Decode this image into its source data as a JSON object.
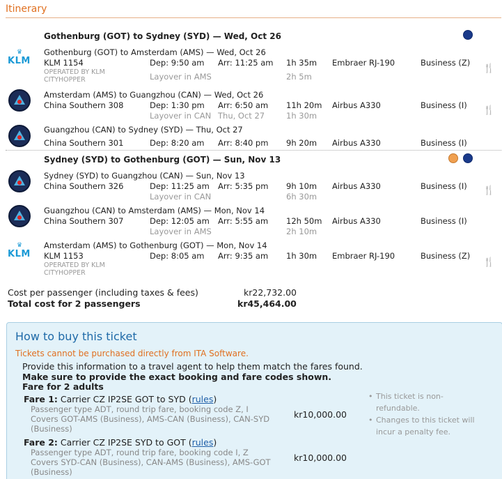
{
  "section_title": "Itinerary",
  "slices": [
    {
      "header": "Gothenburg (GOT) to Sydney (SYD) — Wed, Oct 26",
      "flights": [
        {
          "route": "Gothenburg (GOT) to Amsterdam (AMS) — Wed, Oct 26",
          "carrier": "KLM 1154",
          "operated_by": "OPERATED BY KLM CITYHOPPER",
          "dep": "Dep: 9:50 am",
          "arr": "Arr: 11:25 am",
          "duration": "1h 35m",
          "aircraft": "Embraer RJ-190",
          "cabin": "Business (Z)",
          "layover": "Layover in AMS",
          "layover_duration": "2h 5m",
          "logo": "klm-logo"
        },
        {
          "route": "Amsterdam (AMS) to Guangzhou (CAN) — Wed, Oct 26",
          "carrier": "China Southern 308",
          "dep": "Dep: 1:30 pm",
          "arr": "Arr: 6:50 am",
          "duration": "11h 20m",
          "aircraft": "Airbus A330",
          "cabin": "Business (I)",
          "layover": "Layover in CAN",
          "layover_date": "Thu, Oct 27",
          "layover_duration": "1h 30m",
          "logo": "china-southern-logo"
        },
        {
          "route": "Guangzhou (CAN) to Sydney (SYD) — Thu, Oct 27",
          "carrier": "China Southern 301",
          "dep": "Dep: 8:20 am",
          "arr": "Arr: 8:40 pm",
          "duration": "9h 20m",
          "aircraft": "Airbus A330",
          "cabin": "Business (I)",
          "logo": "china-southern-logo"
        }
      ]
    },
    {
      "header": "Sydney (SYD) to Gothenburg (GOT) — Sun, Nov 13",
      "flights": [
        {
          "route": "Sydney (SYD) to Guangzhou (CAN) — Sun, Nov 13",
          "carrier": "China Southern 326",
          "dep": "Dep: 11:25 am",
          "arr": "Arr: 5:35 pm",
          "duration": "9h 10m",
          "aircraft": "Airbus A330",
          "cabin": "Business (I)",
          "layover": "Layover in CAN",
          "layover_duration": "6h 30m",
          "logo": "china-southern-logo"
        },
        {
          "route": "Guangzhou (CAN) to Amsterdam (AMS) — Mon, Nov 14",
          "carrier": "China Southern 307",
          "dep": "Dep: 12:05 am",
          "arr": "Arr: 5:55 am",
          "duration": "12h 50m",
          "aircraft": "Airbus A330",
          "cabin": "Business (I)",
          "layover": "Layover in AMS",
          "layover_duration": "2h 10m",
          "logo": "china-southern-logo"
        },
        {
          "route": "Amsterdam (AMS) to Gothenburg (GOT) — Mon, Nov 14",
          "carrier": "KLM 1153",
          "operated_by": "OPERATED BY KLM CITYHOPPER",
          "dep": "Dep: 8:05 am",
          "arr": "Arr: 9:35 am",
          "duration": "1h 30m",
          "aircraft": "Embraer RJ-190",
          "cabin": "Business (Z)",
          "logo": "klm-logo"
        }
      ]
    }
  ],
  "klm_text": "KLM",
  "klm_crown": "♛",
  "meal_icon": "🍴",
  "costs": {
    "per_passenger_label": "Cost per passenger (including taxes & fees)",
    "per_passenger_value": "kr22,732.00",
    "total_label": "Total cost for 2 passengers",
    "total_value": "kr45,464.00"
  },
  "how_to_buy": {
    "title": "How to buy this ticket",
    "warning": "Tickets cannot be purchased directly from ITA Software.",
    "line1": "Provide this information to a travel agent to help them match the fares found.",
    "line2": "Make sure to provide the exact booking and fare codes shown.",
    "fare_for": "Fare for 2 adults",
    "fares": [
      {
        "label": "Fare 1:",
        "text": "Carrier CZ IP2SE GOT to SYD (",
        "rules": "rules",
        "close": ")",
        "detail1": "Passenger type ADT, round trip fare, booking code Z, I",
        "detail2": "Covers GOT-AMS (Business), AMS-CAN (Business), CAN-SYD",
        "detail3": "(Business)",
        "price": "kr10,000.00"
      },
      {
        "label": "Fare 2:",
        "text": "Carrier CZ IP2SE SYD to GOT (",
        "rules": "rules",
        "close": ")",
        "detail1": "Passenger type ADT, round trip fare, booking code I, Z",
        "detail2": "Covers SYD-CAN (Business), CAN-AMS (Business), AMS-GOT",
        "detail3": "(Business)",
        "price": "kr10,000.00"
      }
    ],
    "notes": [
      "This ticket is non-",
      "refundable.",
      "Changes to this ticket will",
      "incur a penalty fee."
    ],
    "bullet": "•"
  }
}
